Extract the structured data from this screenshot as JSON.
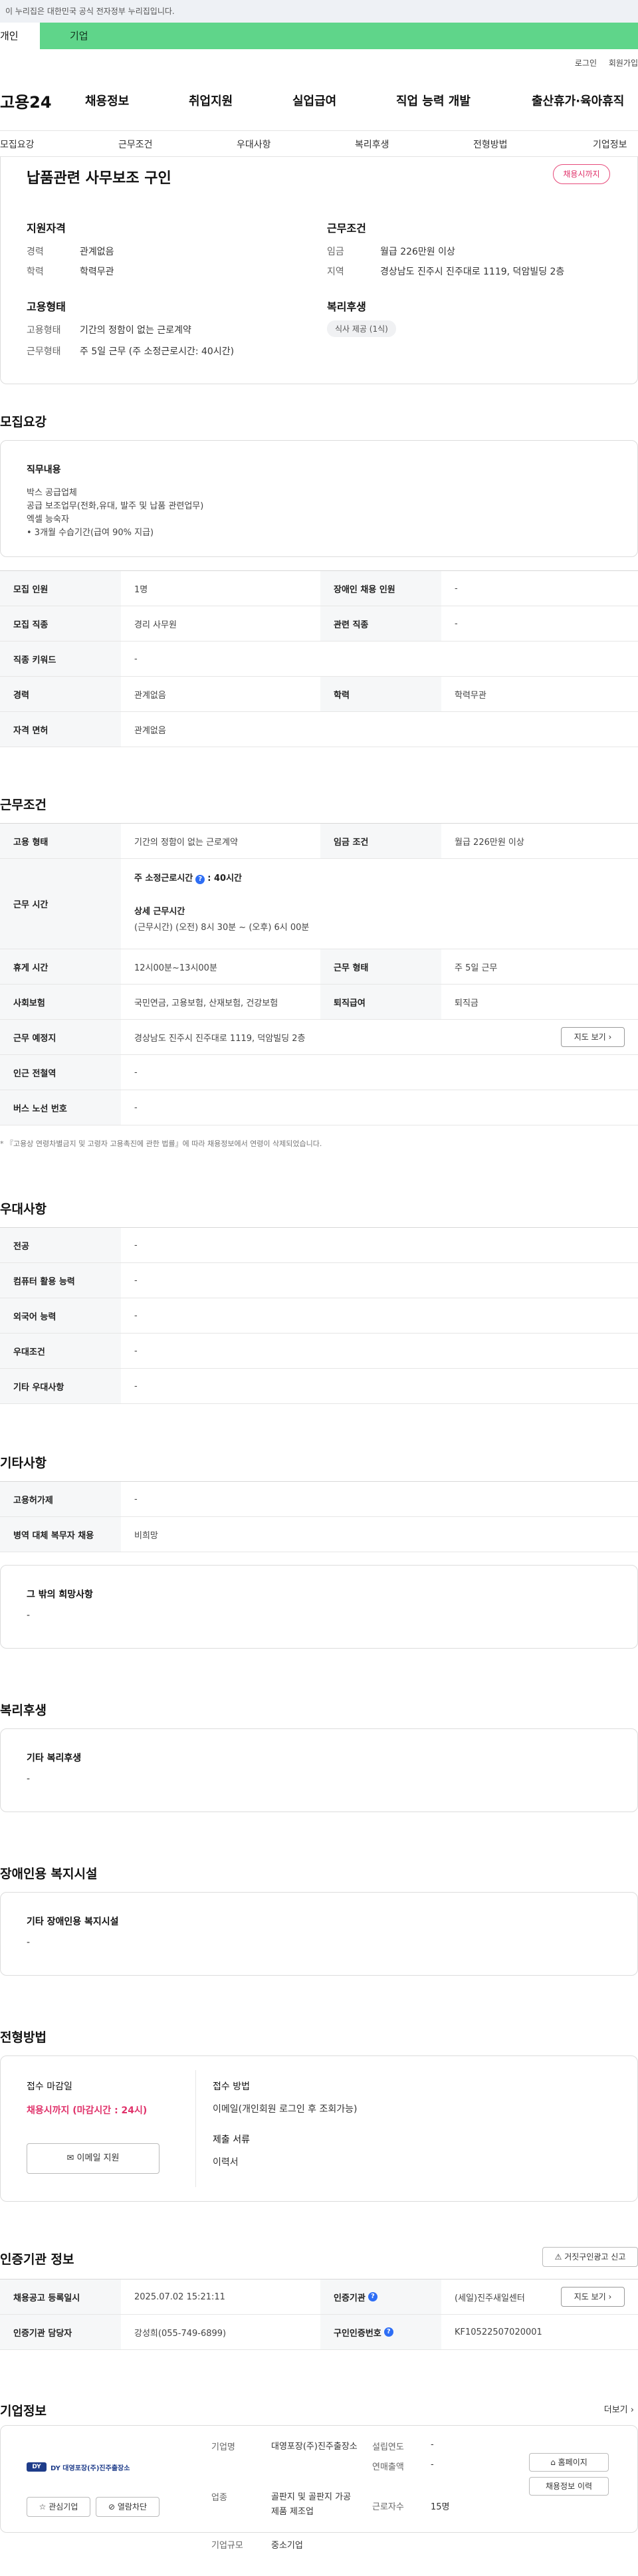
{
  "gov_banner": "이 누리집은 대한민국 공식 전자정부 누리집입니다.",
  "user_tabs": {
    "personal": "개인",
    "business": "기업"
  },
  "util": {
    "login": "로그인",
    "signup": "회원가입"
  },
  "logo": "고용24",
  "gnb": [
    "채용정보",
    "취업지원",
    "실업급여",
    "직업 능력 개발",
    "출산휴가·육아휴직"
  ],
  "subnav": [
    "모집요강",
    "근무조건",
    "우대사항",
    "복리후생",
    "전형방법",
    "기업정보"
  ],
  "job": {
    "title": "납품관련 사무보조 구인",
    "status": "채용시까지",
    "qual_head": "지원자격",
    "career_label": "경력",
    "career_val": "관계없음",
    "edu_label": "학력",
    "edu_val": "학력무관",
    "emp_head": "고용형태",
    "emp_label": "고용형태",
    "emp_val": "기간의 정함이 없는 근로계약",
    "wk_label": "근무형태",
    "wk_val": "주 5일 근무 (주 소정근로시간: 40시간)",
    "cond_head": "근무조건",
    "wage_label": "임금",
    "wage_val": "월급 226만원 이상",
    "area_label": "지역",
    "area_val": "경상남도 진주시 진주대로 1119, 덕암빌딩 2층",
    "welfare_head": "복리후생",
    "welfare_pill": "식사 제공 (1식)"
  },
  "recruit": {
    "title": "모집요강",
    "duty_head": "직무내용",
    "duty_lines": [
      "박스 공급업체",
      "공급 보조업무(전화,유대, 발주 및 납품 관련업무)",
      "엑셀 능숙자",
      "• 3개월 수습기간(급여 90% 지급)"
    ],
    "rows": [
      [
        "모집 인원",
        "1명",
        "장애인 채용 인원",
        "-"
      ],
      [
        "모집 직종",
        "경리 사무원",
        "관련 직종",
        "-"
      ],
      [
        "직종 키워드",
        "-"
      ],
      [
        "경력",
        "관계없음",
        "학력",
        "학력무관"
      ],
      [
        "자격 면허",
        "관계없음"
      ]
    ]
  },
  "work": {
    "title": "근무조건",
    "r1": [
      "고용 형태",
      "기간의 정함이 없는 근로계약",
      "임금 조건",
      "월급 226만원 이상"
    ],
    "hours_label": "근무 시간",
    "hours_weekly_label": "주 소정근로시간",
    "hours_weekly_val": ": 40시간",
    "hours_detail_head": "상세 근무시간",
    "hours_detail": "(근무시간) (오전) 8시 30분 ~ (오후) 6시 00분",
    "r3": [
      "휴게 시간",
      "12시00분~13시00분",
      "근무 형태",
      "주 5일 근무"
    ],
    "r4": [
      "사회보험",
      "국민연금, 고용보험, 산재보험, 건강보험",
      "퇴직급여",
      "퇴직금"
    ],
    "r5": [
      "근무 예정지",
      "경상남도 진주시 진주대로 1119, 덕암빌딩 2층"
    ],
    "map_btn": "지도 보기",
    "r6": [
      "인근 전철역",
      "-"
    ],
    "r7": [
      "버스 노선 번호",
      "-"
    ],
    "note": "* 『고용상 연령차별금지 및 고령자 고용촉진에 관한 법률』에 따라 채용정보에서 연령이 삭제되었습니다."
  },
  "pref": {
    "title": "우대사항",
    "rows": [
      [
        "전공",
        "-"
      ],
      [
        "컴퓨터 활용 능력",
        "-"
      ],
      [
        "외국어 능력",
        "-"
      ],
      [
        "우대조건",
        "-"
      ],
      [
        "기타 우대사항",
        "-"
      ]
    ]
  },
  "etc": {
    "title": "기타사항",
    "rows": [
      [
        "고용허가제",
        "-"
      ],
      [
        "병역 대체 복무자 채용",
        "비희망"
      ]
    ],
    "other_head": "그 밖의 희망사항",
    "other_val": "-"
  },
  "welfare": {
    "title": "복리후생",
    "head": "기타 복리후생",
    "val": "-"
  },
  "disab": {
    "title": "장애인용 복지시설",
    "head": "기타 장애인용 복지시설",
    "val": "-"
  },
  "selection": {
    "title": "전형방법",
    "deadline_head": "접수 마감일",
    "deadline_val": "채용시까지 (마감시간 : 24시)",
    "email_btn": "이메일 지원",
    "method_head": "접수 방법",
    "method_val": "이메일(개인회원 로그인 후 조회가능)",
    "docs_head": "제출 서류",
    "docs_val": "이력서"
  },
  "cert": {
    "title": "인증기관 정보",
    "report_btn": "거짓구인광고 신고",
    "r1": [
      "채용공고 등록일시",
      "2025.07.02 15:21:11",
      "인증기관",
      "(세일)진주새일센터"
    ],
    "map_btn": "지도 보기",
    "r2": [
      "인증기관 담당자",
      "강성희(055-749-6899)",
      "구인인증번호",
      "KF10522507020001"
    ]
  },
  "company": {
    "title": "기업정보",
    "more": "더보기",
    "logo_text": "DY 대영포장(주)진주출장소",
    "fav_btn": "관심기업",
    "block_btn": "열람차단",
    "name_label": "기업명",
    "name_val": "대영포장(주)진주출장소",
    "industry_label": "업종",
    "industry_val": "골판지 및 골판지 가공제품 제조업",
    "size_label": "기업규모",
    "size_val": "중소기업",
    "founded_label": "설립연도",
    "founded_val": "-",
    "sales_label": "연매출액",
    "sales_val": "-",
    "emp_label": "근로자수",
    "emp_val": "15명",
    "home_btn": "홈페이지",
    "hist_btn": "채용정보 이력"
  }
}
